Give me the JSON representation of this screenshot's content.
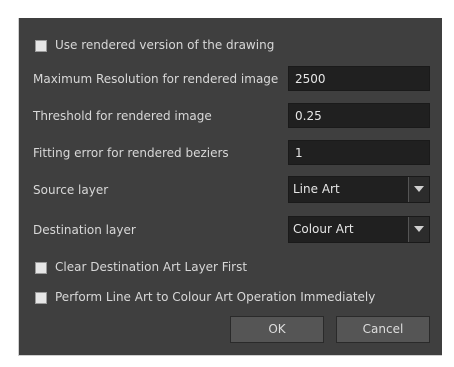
{
  "dialog": {
    "use_rendered": {
      "label": "Use rendered version of the drawing",
      "checked": false
    },
    "fields": {
      "max_resolution": {
        "label": "Maximum Resolution for rendered image",
        "value": "2500"
      },
      "threshold": {
        "label": "Threshold for rendered image",
        "value": "0.25"
      },
      "fitting_error": {
        "label": "Fitting error for rendered beziers",
        "value": "1"
      }
    },
    "source_layer": {
      "label": "Source layer",
      "value": "Line Art"
    },
    "destination_layer": {
      "label": "Destination layer",
      "value": "Colour Art"
    },
    "clear_destination": {
      "label": "Clear Destination Art Layer First",
      "checked": false
    },
    "perform_immediately": {
      "label": "Perform Line Art to Colour Art Operation Immediately",
      "checked": false
    },
    "buttons": {
      "ok": "OK",
      "cancel": "Cancel"
    },
    "icons": {
      "dropdown": "chevron-down-icon"
    },
    "colors": {
      "background": "#3f3f3f",
      "input_background": "#202020",
      "button": "#555555",
      "text": "#d8d8d8"
    }
  }
}
